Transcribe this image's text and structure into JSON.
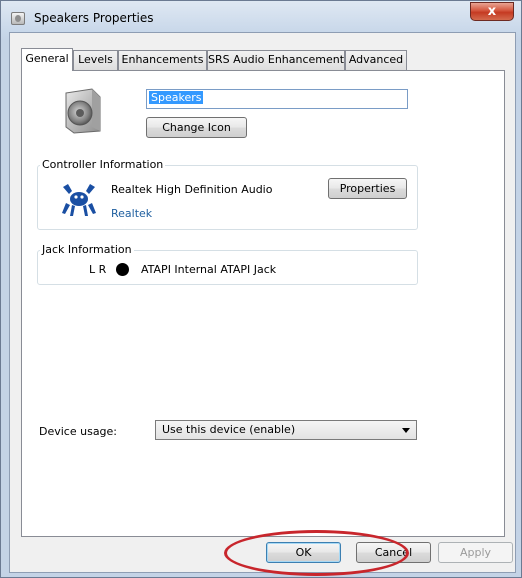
{
  "window": {
    "title": "Speakers Properties",
    "close_label": "x"
  },
  "tabs": [
    {
      "label": "General",
      "active": true
    },
    {
      "label": "Levels",
      "active": false
    },
    {
      "label": "Enhancements",
      "active": false
    },
    {
      "label": "SRS Audio Enhancement",
      "active": false
    },
    {
      "label": "Advanced",
      "active": false
    }
  ],
  "general": {
    "device_name": "Speakers",
    "change_icon_label": "Change Icon",
    "change_icon_accelerator": "I"
  },
  "controller": {
    "legend": "Controller Information",
    "name": "Realtek High Definition Audio",
    "vendor": "Realtek",
    "properties_label": "Properties",
    "properties_accelerator": "P"
  },
  "jack": {
    "legend": "Jack Information",
    "channels": "L R",
    "description": "ATAPI Internal ATAPI Jack",
    "dot_color": "#000000"
  },
  "device_usage": {
    "label": "Device usage:",
    "selected": "Use this device (enable)"
  },
  "footer": {
    "ok_label": "OK",
    "cancel_label": "Cancel",
    "apply_label": "Apply",
    "apply_accelerator": "A"
  },
  "colors": {
    "accent": "#3399ff",
    "annotation": "#c8262c",
    "link": "#1f5f9f"
  }
}
